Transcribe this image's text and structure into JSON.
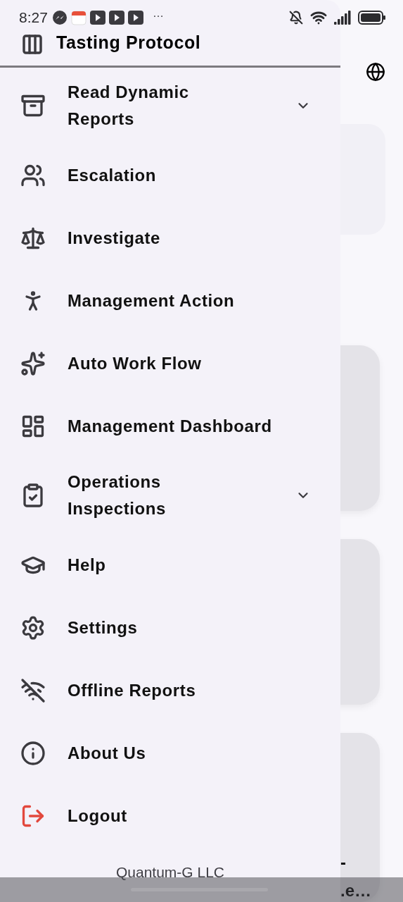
{
  "status_bar": {
    "time": "8:27",
    "overflow": "…"
  },
  "background": {
    "last_card_lines": [
      "-",
      ".e…"
    ]
  },
  "drawer": {
    "title": "Tasting Protocol",
    "items": [
      {
        "label": "Read Dynamic Reports",
        "expandable": true,
        "kind": "normal"
      },
      {
        "label": "Escalation",
        "expandable": false,
        "kind": "normal"
      },
      {
        "label": "Investigate",
        "expandable": false,
        "kind": "normal"
      },
      {
        "label": "Management Action",
        "expandable": false,
        "kind": "normal"
      },
      {
        "label": "Auto Work Flow",
        "expandable": false,
        "kind": "normal"
      },
      {
        "label": "Management Dashboard",
        "expandable": false,
        "kind": "normal"
      },
      {
        "label": "Operations Inspections",
        "expandable": true,
        "kind": "normal"
      },
      {
        "label": "Help",
        "expandable": false,
        "kind": "normal"
      },
      {
        "label": "Settings",
        "expandable": false,
        "kind": "normal"
      },
      {
        "label": "Offline Reports",
        "expandable": false,
        "kind": "normal"
      },
      {
        "label": "About Us",
        "expandable": false,
        "kind": "normal"
      },
      {
        "label": "Logout",
        "expandable": false,
        "kind": "danger"
      }
    ],
    "footer": "Quantum-G LLC"
  }
}
